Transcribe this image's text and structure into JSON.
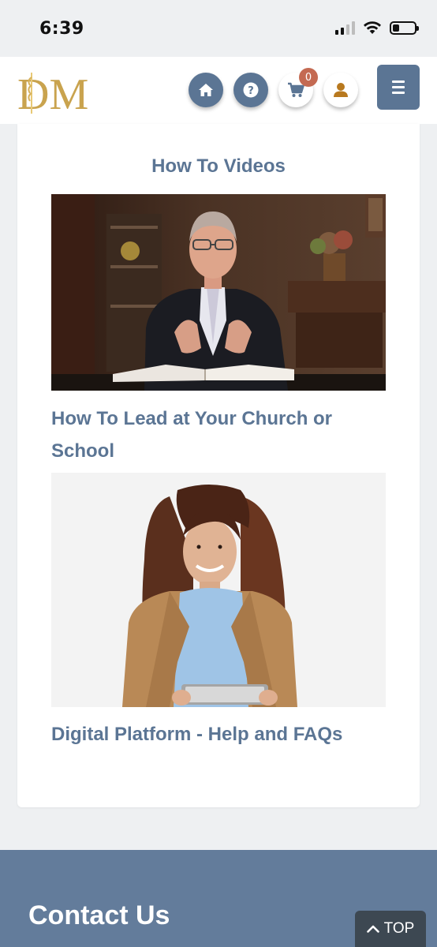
{
  "status_bar": {
    "time": "6:39"
  },
  "header": {
    "logo_text": "DM",
    "icons": [
      "home-icon",
      "help-icon",
      "cart-icon",
      "user-icon",
      "menu-icon"
    ],
    "cart_count": "0"
  },
  "main": {
    "section_title": "How To Videos",
    "items": [
      {
        "title": "How To Lead at Your Church or School"
      },
      {
        "title": "Digital Platform - Help and FAQs"
      }
    ]
  },
  "footer": {
    "title": "Contact Us",
    "top_button_label": "TOP"
  },
  "colors": {
    "accent": "#5b7594",
    "footer": "#637c9b",
    "badge": "#c46a52",
    "logo_gold": "#c9a34e"
  }
}
